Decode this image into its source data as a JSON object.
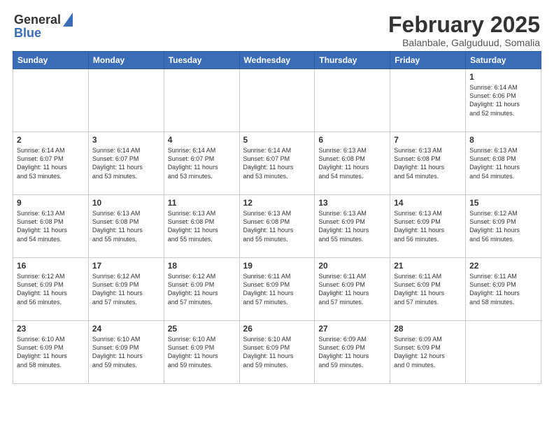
{
  "header": {
    "logo_general": "General",
    "logo_blue": "Blue",
    "title": "February 2025",
    "subtitle": "Balanbale, Galguduud, Somalia"
  },
  "weekdays": [
    "Sunday",
    "Monday",
    "Tuesday",
    "Wednesday",
    "Thursday",
    "Friday",
    "Saturday"
  ],
  "weeks": [
    [
      {
        "num": "",
        "info": ""
      },
      {
        "num": "",
        "info": ""
      },
      {
        "num": "",
        "info": ""
      },
      {
        "num": "",
        "info": ""
      },
      {
        "num": "",
        "info": ""
      },
      {
        "num": "",
        "info": ""
      },
      {
        "num": "1",
        "info": "Sunrise: 6:14 AM\nSunset: 6:06 PM\nDaylight: 11 hours\nand 52 minutes."
      }
    ],
    [
      {
        "num": "2",
        "info": "Sunrise: 6:14 AM\nSunset: 6:07 PM\nDaylight: 11 hours\nand 53 minutes."
      },
      {
        "num": "3",
        "info": "Sunrise: 6:14 AM\nSunset: 6:07 PM\nDaylight: 11 hours\nand 53 minutes."
      },
      {
        "num": "4",
        "info": "Sunrise: 6:14 AM\nSunset: 6:07 PM\nDaylight: 11 hours\nand 53 minutes."
      },
      {
        "num": "5",
        "info": "Sunrise: 6:14 AM\nSunset: 6:07 PM\nDaylight: 11 hours\nand 53 minutes."
      },
      {
        "num": "6",
        "info": "Sunrise: 6:13 AM\nSunset: 6:08 PM\nDaylight: 11 hours\nand 54 minutes."
      },
      {
        "num": "7",
        "info": "Sunrise: 6:13 AM\nSunset: 6:08 PM\nDaylight: 11 hours\nand 54 minutes."
      },
      {
        "num": "8",
        "info": "Sunrise: 6:13 AM\nSunset: 6:08 PM\nDaylight: 11 hours\nand 54 minutes."
      }
    ],
    [
      {
        "num": "9",
        "info": "Sunrise: 6:13 AM\nSunset: 6:08 PM\nDaylight: 11 hours\nand 54 minutes."
      },
      {
        "num": "10",
        "info": "Sunrise: 6:13 AM\nSunset: 6:08 PM\nDaylight: 11 hours\nand 55 minutes."
      },
      {
        "num": "11",
        "info": "Sunrise: 6:13 AM\nSunset: 6:08 PM\nDaylight: 11 hours\nand 55 minutes."
      },
      {
        "num": "12",
        "info": "Sunrise: 6:13 AM\nSunset: 6:08 PM\nDaylight: 11 hours\nand 55 minutes."
      },
      {
        "num": "13",
        "info": "Sunrise: 6:13 AM\nSunset: 6:09 PM\nDaylight: 11 hours\nand 55 minutes."
      },
      {
        "num": "14",
        "info": "Sunrise: 6:13 AM\nSunset: 6:09 PM\nDaylight: 11 hours\nand 56 minutes."
      },
      {
        "num": "15",
        "info": "Sunrise: 6:12 AM\nSunset: 6:09 PM\nDaylight: 11 hours\nand 56 minutes."
      }
    ],
    [
      {
        "num": "16",
        "info": "Sunrise: 6:12 AM\nSunset: 6:09 PM\nDaylight: 11 hours\nand 56 minutes."
      },
      {
        "num": "17",
        "info": "Sunrise: 6:12 AM\nSunset: 6:09 PM\nDaylight: 11 hours\nand 57 minutes."
      },
      {
        "num": "18",
        "info": "Sunrise: 6:12 AM\nSunset: 6:09 PM\nDaylight: 11 hours\nand 57 minutes."
      },
      {
        "num": "19",
        "info": "Sunrise: 6:11 AM\nSunset: 6:09 PM\nDaylight: 11 hours\nand 57 minutes."
      },
      {
        "num": "20",
        "info": "Sunrise: 6:11 AM\nSunset: 6:09 PM\nDaylight: 11 hours\nand 57 minutes."
      },
      {
        "num": "21",
        "info": "Sunrise: 6:11 AM\nSunset: 6:09 PM\nDaylight: 11 hours\nand 57 minutes."
      },
      {
        "num": "22",
        "info": "Sunrise: 6:11 AM\nSunset: 6:09 PM\nDaylight: 11 hours\nand 58 minutes."
      }
    ],
    [
      {
        "num": "23",
        "info": "Sunrise: 6:10 AM\nSunset: 6:09 PM\nDaylight: 11 hours\nand 58 minutes."
      },
      {
        "num": "24",
        "info": "Sunrise: 6:10 AM\nSunset: 6:09 PM\nDaylight: 11 hours\nand 59 minutes."
      },
      {
        "num": "25",
        "info": "Sunrise: 6:10 AM\nSunset: 6:09 PM\nDaylight: 11 hours\nand 59 minutes."
      },
      {
        "num": "26",
        "info": "Sunrise: 6:10 AM\nSunset: 6:09 PM\nDaylight: 11 hours\nand 59 minutes."
      },
      {
        "num": "27",
        "info": "Sunrise: 6:09 AM\nSunset: 6:09 PM\nDaylight: 11 hours\nand 59 minutes."
      },
      {
        "num": "28",
        "info": "Sunrise: 6:09 AM\nSunset: 6:09 PM\nDaylight: 12 hours\nand 0 minutes."
      },
      {
        "num": "",
        "info": ""
      }
    ]
  ]
}
